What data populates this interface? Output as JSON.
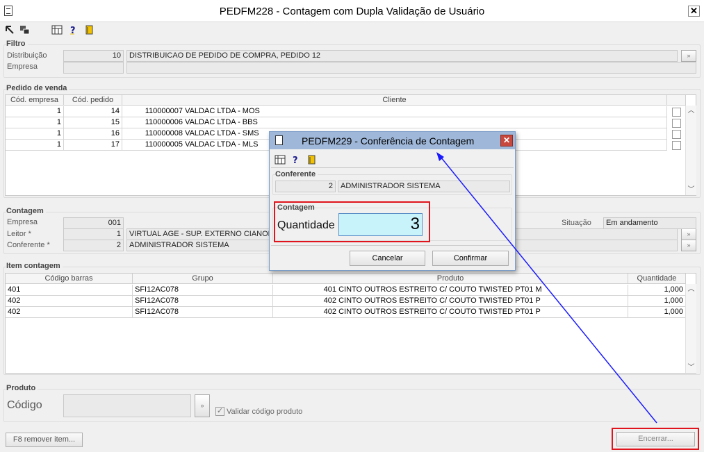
{
  "window": {
    "title": "PEDFM228 - Contagem com Dupla Validação de Usuário",
    "close_glyph": "✕"
  },
  "toolbar": {
    "icons": [
      "pointer-icon",
      "windows-icon",
      "calculator-icon",
      "help-icon",
      "exit-icon"
    ]
  },
  "filtro": {
    "group_title": "Filtro",
    "distribuicao_label": "Distribuição",
    "distribuicao_code": "10",
    "distribuicao_desc": "DISTRIBUICAO DE PEDIDO DE COMPRA, PEDIDO 12",
    "empresa_label": "Empresa",
    "empresa_code": "",
    "empresa_desc": ""
  },
  "pedido": {
    "group_title": "Pedido de venda",
    "headers": [
      "Cód. empresa",
      "Cód. pedido",
      "Cliente"
    ],
    "rows": [
      {
        "empresa": "1",
        "pedido": "14",
        "cod": "110000007",
        "cliente": "VALDAC LTDA - MOS"
      },
      {
        "empresa": "1",
        "pedido": "15",
        "cod": "110000006",
        "cliente": "VALDAC LTDA - BBS"
      },
      {
        "empresa": "1",
        "pedido": "16",
        "cod": "110000008",
        "cliente": "VALDAC LTDA - SMS"
      },
      {
        "empresa": "1",
        "pedido": "17",
        "cod": "110000005",
        "cliente": "VALDAC LTDA - MLS"
      }
    ]
  },
  "contagem": {
    "group_title": "Contagem",
    "empresa_label": "Empresa",
    "empresa_value": "001",
    "leitor_label": "Leitor *",
    "leitor_code": "1",
    "leitor_desc": "VIRTUAL AGE - SUP. EXTERNO CIANORTE",
    "conferente_label": "Conferente *",
    "conferente_code": "2",
    "conferente_desc": "ADMINISTRADOR SISTEMA",
    "situacao_label": "Situação",
    "situacao_value": "Em andamento"
  },
  "item": {
    "group_title": "Item contagem",
    "headers": [
      "Código barras",
      "Grupo",
      "Produto",
      "Quantidade"
    ],
    "rows": [
      {
        "barras": "401",
        "grupo": "SFI12AC078",
        "prod_code": "401",
        "produto": "CINTO OUTROS ESTREITO C/ COUTO TWISTED PT01 M",
        "qtd": "1,000"
      },
      {
        "barras": "402",
        "grupo": "SFI12AC078",
        "prod_code": "402",
        "produto": "CINTO OUTROS ESTREITO C/ COUTO TWISTED PT01 P",
        "qtd": "1,000"
      },
      {
        "barras": "402",
        "grupo": "SFI12AC078",
        "prod_code": "402",
        "produto": "CINTO OUTROS ESTREITO C/ COUTO TWISTED PT01 P",
        "qtd": "1,000"
      }
    ]
  },
  "produto": {
    "group_title": "Produto",
    "codigo_label": "Código",
    "codigo_value": "",
    "validar_label": "Validar código produto",
    "validar_checked": true
  },
  "footer": {
    "remover_label": "F8 remover item...",
    "encerrar_label": "Encerrar..."
  },
  "dialog": {
    "title": "PEDFM229 - Conferência de Contagem",
    "close_glyph": "✕",
    "conferente_group": "Conferente",
    "conferente_code": "2",
    "conferente_desc": "ADMINISTRADOR SISTEMA",
    "contagem_group": "Contagem",
    "quantidade_label": "Quantidade",
    "quantidade_value": "3",
    "cancelar_label": "Cancelar",
    "confirmar_label": "Confirmar"
  },
  "colors": {
    "highlight": "#e0141c",
    "arrow": "#1a1aff",
    "dialog_title": "#9fb7d8",
    "quantity_bg": "#c9f3fb"
  }
}
